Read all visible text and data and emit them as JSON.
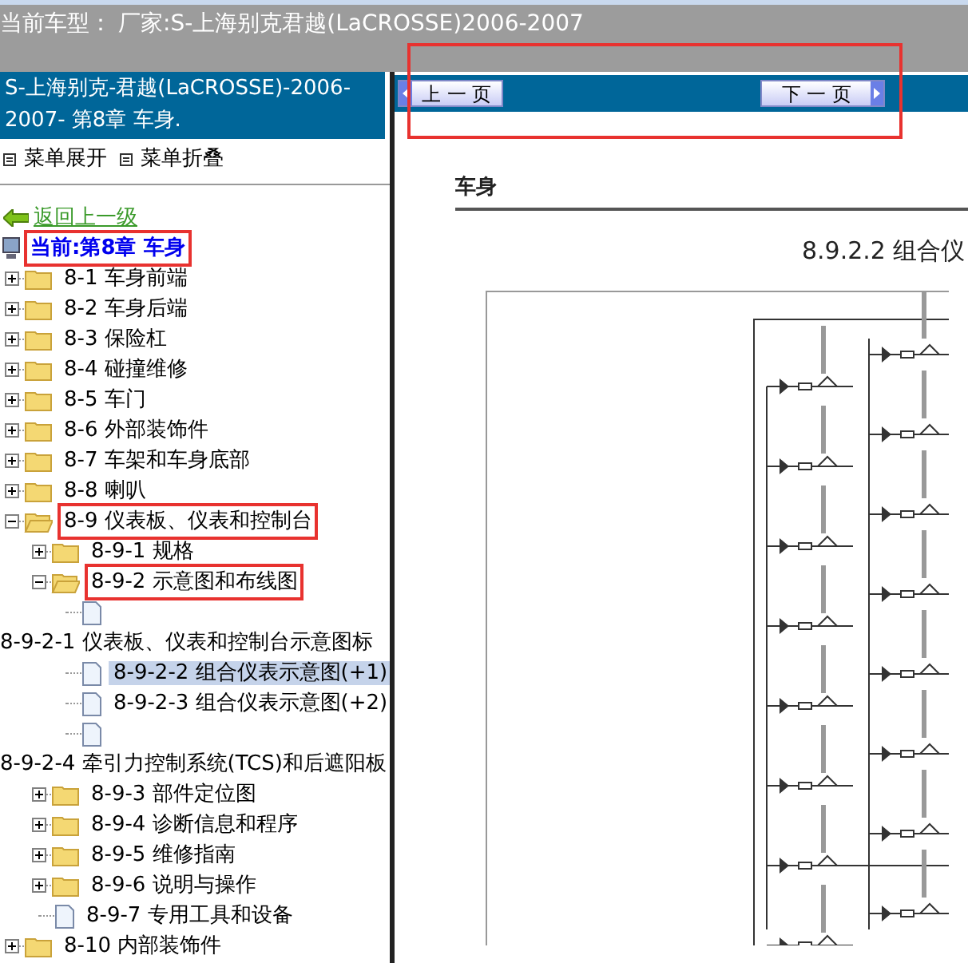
{
  "header": {
    "vehicle_label": "当前车型：",
    "vehicle": "厂家:S-上海别克君越(LaCROSSE)2006-2007"
  },
  "sidebar": {
    "title": "S-上海别克-君越(LaCROSSE)-2006-2007- 第8章 车身.",
    "actions": [
      {
        "label": "菜单展开"
      },
      {
        "label": "菜单折叠"
      }
    ],
    "back_link": "返回上一级",
    "current": {
      "label": "当前:第8章 车身",
      "marked": true
    },
    "tree": [
      {
        "label": "8-1 车身前端",
        "kind": "folder",
        "expanded": false,
        "marked": false
      },
      {
        "label": "8-2 车身后端",
        "kind": "folder",
        "expanded": false,
        "marked": false
      },
      {
        "label": "8-3 保险杠",
        "kind": "folder",
        "expanded": false,
        "marked": false
      },
      {
        "label": "8-4 碰撞维修",
        "kind": "folder",
        "expanded": false,
        "marked": false
      },
      {
        "label": "8-5 车门",
        "kind": "folder",
        "expanded": false,
        "marked": false
      },
      {
        "label": "8-6 外部装饰件",
        "kind": "folder",
        "expanded": false,
        "marked": false
      },
      {
        "label": "8-7 车架和车身底部",
        "kind": "folder",
        "expanded": false,
        "marked": false
      },
      {
        "label": "8-8 喇叭",
        "kind": "folder",
        "expanded": false,
        "marked": false
      },
      {
        "label": "8-9 仪表板、仪表和控制台",
        "kind": "folder",
        "expanded": true,
        "marked": true,
        "children": [
          {
            "label": "8-9-1 规格",
            "kind": "folder",
            "expanded": false,
            "marked": false
          },
          {
            "label": "8-9-2 示意图和布线图",
            "kind": "folder",
            "expanded": true,
            "marked": true,
            "children": [
              {
                "label": "8-9-2-1 仪表板、仪表和控制台示意图标",
                "kind": "page_wrapped",
                "selected": false
              },
              {
                "label": "8-9-2-2 组合仪表示意图(+1)",
                "kind": "page",
                "selected": true
              },
              {
                "label": "8-9-2-3 组合仪表示意图(+2)",
                "kind": "page",
                "selected": false
              },
              {
                "label": "8-9-2-4 牵引力控制系统(TCS)和后遮阳板",
                "kind": "page_wrapped",
                "selected": false
              }
            ]
          },
          {
            "label": "8-9-3 部件定位图",
            "kind": "folder",
            "expanded": false,
            "marked": false
          },
          {
            "label": "8-9-4 诊断信息和程序",
            "kind": "folder",
            "expanded": false,
            "marked": false
          },
          {
            "label": "8-9-5 维修指南",
            "kind": "folder",
            "expanded": false,
            "marked": false
          },
          {
            "label": "8-9-6 说明与操作",
            "kind": "folder",
            "expanded": false,
            "marked": false
          },
          {
            "label": "8-9-7 专用工具和设备",
            "kind": "page",
            "selected": false
          }
        ]
      },
      {
        "label": "8-10 内部装饰件",
        "kind": "folder",
        "expanded": false,
        "marked": false
      }
    ]
  },
  "viewer": {
    "nav": {
      "marked": true,
      "buttons": [
        {
          "label": "上 一 页",
          "kind": "prev"
        },
        {
          "label": "下 一 页",
          "kind": "next"
        }
      ]
    },
    "document": {
      "section": "车身",
      "title": "8.9.2.2 组合仪"
    }
  }
}
